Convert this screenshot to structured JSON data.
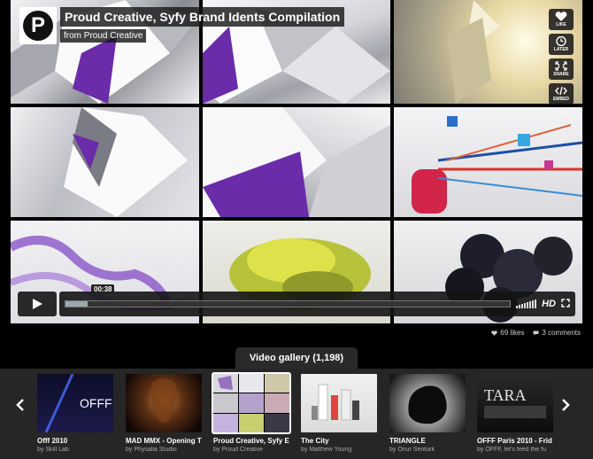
{
  "video": {
    "title": "Proud Creative, Syfy Brand Idents Compilation",
    "byline_prefix": "from",
    "owner": "Proud Creative",
    "logo_letter": "P",
    "timecode": "00:38",
    "progress": 0.05,
    "hd_label": "HD"
  },
  "side_actions": [
    {
      "label": "LIKE",
      "icon": "heart-icon"
    },
    {
      "label": "LATER",
      "icon": "clock-icon"
    },
    {
      "label": "SHARE",
      "icon": "share-icon"
    },
    {
      "label": "EMBED",
      "icon": "embed-icon"
    }
  ],
  "stats": {
    "likes": "69 likes",
    "comments": "3 comments"
  },
  "gallery": {
    "tab_label": "Video gallery (1,198)",
    "items": [
      {
        "title": "Offf 2010",
        "by": "by Skill Lab"
      },
      {
        "title": "MAD MMX - Opening T",
        "by": "by Physalia Studio"
      },
      {
        "title": "Proud Creative, Syfy E",
        "by": "by Proud Creative"
      },
      {
        "title": "The City",
        "by": "by Matthew Young"
      },
      {
        "title": "TRIANGLE",
        "by": "by Onur Senturk"
      },
      {
        "title": "OFFF Paris 2010 - Frid",
        "by": "by OFFF, let's feed the fu"
      }
    ],
    "thumb_texts": {
      "offf": "OFFF",
      "tara": "TARA"
    }
  },
  "colors": {
    "accent_purple": "#6a2ca8",
    "background": "#000000",
    "panel": "#262626"
  }
}
